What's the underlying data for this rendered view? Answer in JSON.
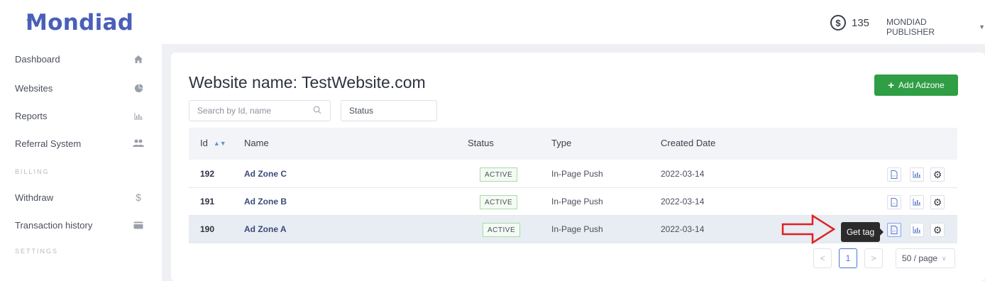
{
  "header": {
    "logo": "Mondiad",
    "balance_value": "135",
    "user_label": "MONDIAD PUBLISHER"
  },
  "sidebar": {
    "items": [
      {
        "label": "Dashboard",
        "icon": "home-icon"
      },
      {
        "label": "Websites",
        "icon": "pie-chart-icon"
      },
      {
        "label": "Reports",
        "icon": "bar-chart-icon"
      },
      {
        "label": "Referral System",
        "icon": "users-icon"
      },
      {
        "label": "Withdraw",
        "icon": "dollar-icon"
      },
      {
        "label": "Transaction history",
        "icon": "wallet-icon"
      }
    ],
    "sections": {
      "billing": "BILLING",
      "settings": "SETTINGS"
    }
  },
  "main": {
    "title": "Website name: TestWebsite.com",
    "add_button": "Add Adzone",
    "search_placeholder": "Search by Id, name",
    "status_filter": "Status"
  },
  "table": {
    "columns": [
      "Id",
      "Name",
      "Status",
      "Type",
      "Created Date"
    ],
    "rows": [
      {
        "id": "192",
        "name": "Ad Zone C",
        "status": "ACTIVE",
        "type": "In-Page Push",
        "date": "2022-03-14"
      },
      {
        "id": "191",
        "name": "Ad Zone B",
        "status": "ACTIVE",
        "type": "In-Page Push",
        "date": "2022-03-14"
      },
      {
        "id": "190",
        "name": "Ad Zone A",
        "status": "ACTIVE",
        "type": "In-Page Push",
        "date": "2022-03-14"
      }
    ]
  },
  "tooltip": "Get tag",
  "pagination": {
    "prev": "<",
    "current": "1",
    "next": ">",
    "page_size": "50 / page"
  },
  "colors": {
    "brand": "#4a5fb8",
    "accent_green": "#2f9e44",
    "arrow_red": "#e02020"
  }
}
